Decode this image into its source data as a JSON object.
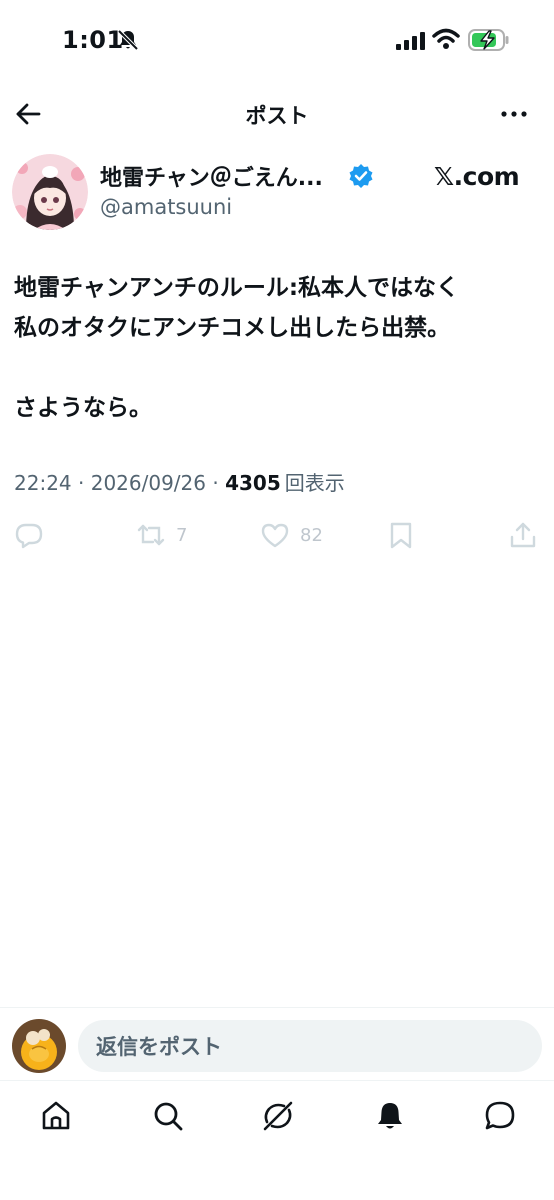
{
  "status_bar": {
    "time": "1:01"
  },
  "header": {
    "title": "ポスト"
  },
  "author": {
    "name": "地雷チャン＠ごえん...",
    "handle": "@amatsuuni",
    "source": "𝕏.com"
  },
  "post": {
    "text": "地雷チャンアンチのルール:私本人ではなく\n私のオタクにアンチコメし出したら出禁。\n\nさようなら。",
    "time": "22:24",
    "date": "2026/09/26",
    "views_count": "4305",
    "views_label": "回表示",
    "separator": " · "
  },
  "actions": {
    "repost_count": "7",
    "like_count": "82"
  },
  "reply_bar": {
    "placeholder": "返信をポスト"
  },
  "icons": {
    "back": "back-arrow-icon",
    "more": "more-icon",
    "verified": "verified-badge-icon",
    "reply": "reply-icon",
    "repost": "repost-icon",
    "like": "heart-icon",
    "bookmark": "bookmark-icon",
    "share": "share-icon",
    "home": "home-icon",
    "search": "search-icon",
    "grok": "grok-icon",
    "notifications": "bell-icon",
    "messages": "messages-icon"
  },
  "colors": {
    "text": "#0f1419",
    "secondary": "#536471",
    "verified": "#1d9bf0",
    "input_bg": "#eff3f4",
    "battery_fill": "#34c759"
  }
}
